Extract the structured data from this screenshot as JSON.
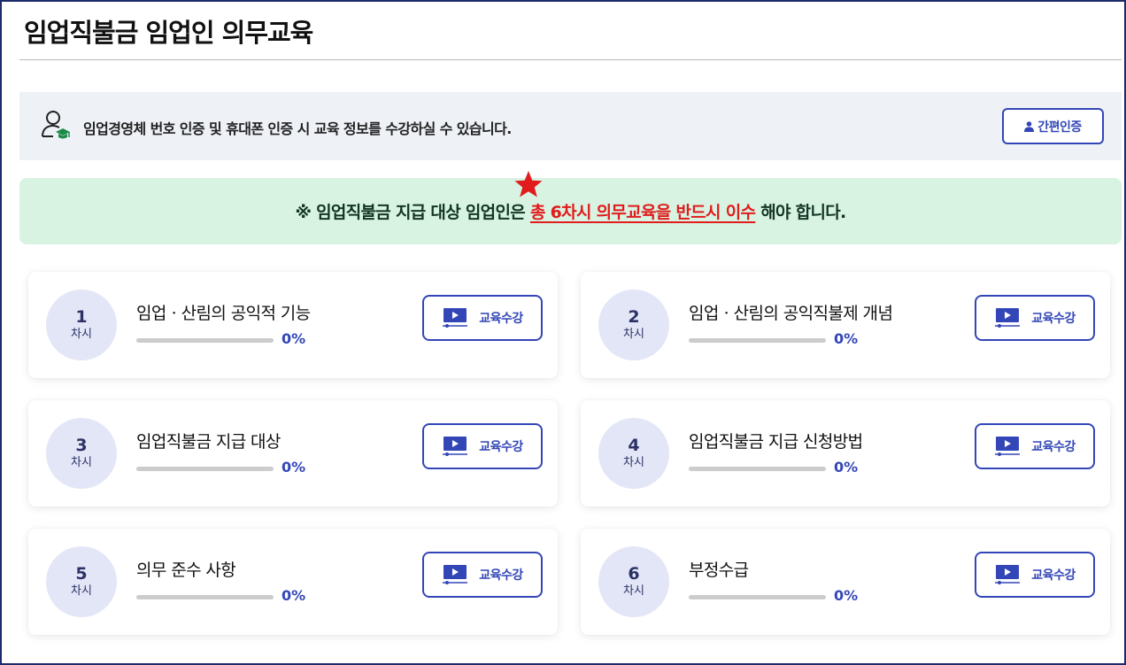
{
  "page": {
    "title": "임업직불금 임업인 의무교육"
  },
  "auth_bar": {
    "message": "임업경영체 번호 인증 및 휴대폰 인증 시 교육 정보를 수강하실 수 있습니다.",
    "button_label": "간편인증"
  },
  "notice": {
    "prefix": "※ 임업직불금 지급 대상 임업인은 ",
    "highlight": "총 6차시 의무교육을 반드시 이수",
    "suffix": " 해야 합니다."
  },
  "colors": {
    "accent": "#3346b7",
    "notice_bg": "#d9f3e3",
    "highlight": "#e01c1c",
    "star": "#e01c1c"
  },
  "lessons": [
    {
      "number": "1",
      "unit": "차시",
      "title": "임업ㆍ산림의 공익적 기능",
      "progress": 0,
      "progress_label": "0%",
      "button_label": "교육수강"
    },
    {
      "number": "2",
      "unit": "차시",
      "title": "임업ㆍ산림의 공익직불제 개념",
      "progress": 0,
      "progress_label": "0%",
      "button_label": "교육수강"
    },
    {
      "number": "3",
      "unit": "차시",
      "title": "임업직불금 지급 대상",
      "progress": 0,
      "progress_label": "0%",
      "button_label": "교육수강"
    },
    {
      "number": "4",
      "unit": "차시",
      "title": "임업직불금 지급 신청방법",
      "progress": 0,
      "progress_label": "0%",
      "button_label": "교육수강"
    },
    {
      "number": "5",
      "unit": "차시",
      "title": "의무 준수 사항",
      "progress": 0,
      "progress_label": "0%",
      "button_label": "교육수강"
    },
    {
      "number": "6",
      "unit": "차시",
      "title": "부정수급",
      "progress": 0,
      "progress_label": "0%",
      "button_label": "교육수강"
    }
  ]
}
